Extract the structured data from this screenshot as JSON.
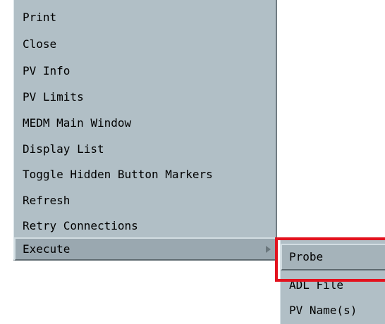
{
  "context_menu": {
    "items": [
      {
        "label": "Print"
      },
      {
        "label": "Close"
      },
      {
        "label": "PV Info"
      },
      {
        "label": "PV Limits"
      },
      {
        "label": "MEDM Main Window"
      },
      {
        "label": "Display List"
      },
      {
        "label": "Toggle Hidden Button Markers"
      },
      {
        "label": "Refresh"
      },
      {
        "label": "Retry Connections"
      },
      {
        "label": "Execute",
        "has_submenu": true,
        "active": true
      }
    ]
  },
  "execute_submenu": {
    "items": [
      {
        "label": "Probe",
        "active": true
      },
      {
        "label": "ADL File"
      },
      {
        "label": "PV Name(s)"
      }
    ]
  },
  "colors": {
    "menu_bg": "#b1bfc6",
    "highlight_border": "#e3121e"
  }
}
